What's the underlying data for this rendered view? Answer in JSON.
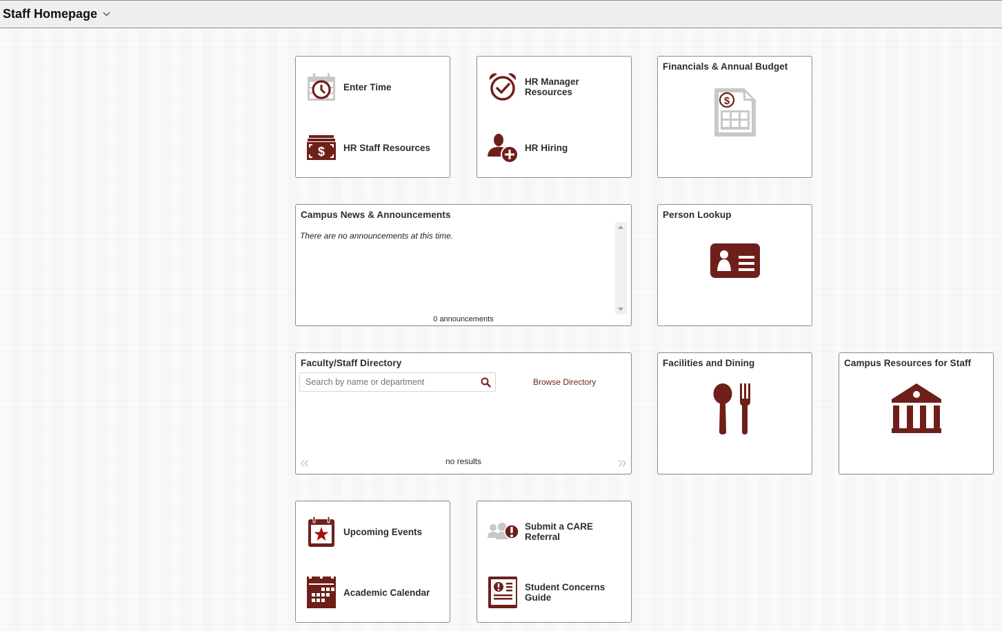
{
  "header": {
    "title": "Staff Homepage",
    "dropdown_icon": "chevron-down-icon"
  },
  "colors": {
    "brand": "#6e1f1a",
    "icon_gray": "#c8c8c8",
    "border": "#8d8a86"
  },
  "tiles": {
    "time_hr": {
      "links": [
        {
          "label": "Enter Time",
          "icon": "calendar-clock-icon"
        },
        {
          "label": "HR Staff Resources",
          "icon": "money-stack-icon"
        }
      ]
    },
    "hr_manager": {
      "links": [
        {
          "label": "HR Manager Resources",
          "icon": "alarm-check-icon"
        },
        {
          "label": "HR Hiring",
          "icon": "user-add-icon"
        }
      ]
    },
    "financials": {
      "title": "Financials & Annual Budget",
      "icon": "budget-document-icon"
    },
    "news": {
      "title": "Campus News & Announcements",
      "message": "There are no announcements at this time.",
      "count": "0 announcements"
    },
    "person_lookup": {
      "title": "Person Lookup",
      "icon": "id-card-icon"
    },
    "directory": {
      "title": "Faculty/Staff Directory",
      "search_placeholder": "Search by name or department",
      "search_value": "",
      "browse_label": "Browse Directory",
      "results_text": "no results",
      "prev_label": "«",
      "next_label": "»"
    },
    "facilities": {
      "title": "Facilities and Dining",
      "icon": "utensils-icon"
    },
    "campus_resources": {
      "title": "Campus Resources for Staff",
      "icon": "institution-icon"
    },
    "events": {
      "links": [
        {
          "label": "Upcoming Events",
          "icon": "calendar-star-icon"
        },
        {
          "label": "Academic Calendar",
          "icon": "calendar-grid-icon"
        }
      ]
    },
    "care": {
      "links": [
        {
          "label": "Submit a CARE Referral",
          "icon": "group-alert-icon"
        },
        {
          "label": "Student Concerns Guide",
          "icon": "alert-document-icon"
        }
      ]
    }
  }
}
